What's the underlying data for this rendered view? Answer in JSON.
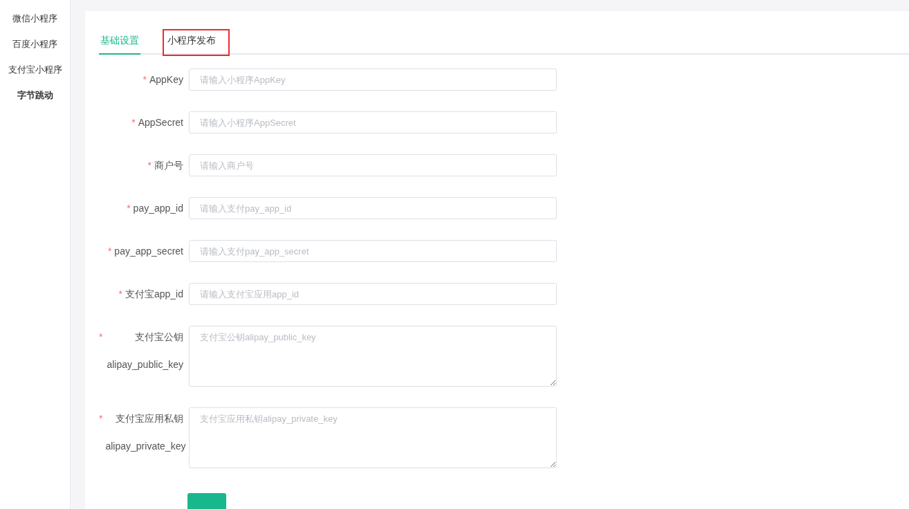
{
  "sidebar": {
    "items": [
      {
        "label": "微信小程序",
        "selected": false
      },
      {
        "label": "百度小程序",
        "selected": false
      },
      {
        "label": "支付宝小程序",
        "selected": false
      },
      {
        "label": "字节跳动",
        "selected": true
      }
    ]
  },
  "tabs": [
    {
      "label": "基础设置",
      "selected": true,
      "highlighted": false
    },
    {
      "label": "小程序发布",
      "selected": false,
      "highlighted": true
    }
  ],
  "form": {
    "fields": [
      {
        "kind": "input",
        "label": "AppKey",
        "required_mark": "*",
        "placeholder": "请输入小程序AppKey"
      },
      {
        "kind": "input",
        "label": "AppSecret",
        "required_mark": "*",
        "placeholder": "请输入小程序AppSecret"
      },
      {
        "kind": "input",
        "label": "商户号",
        "required_mark": "*",
        "placeholder": "请输入商户号"
      },
      {
        "kind": "input",
        "label": "pay_app_id",
        "required_mark": "*",
        "placeholder": "请输入支付pay_app_id"
      },
      {
        "kind": "input",
        "label": "pay_app_secret",
        "required_mark": "*",
        "placeholder": "请输入支付pay_app_secret"
      },
      {
        "kind": "input",
        "label": "支付宝app_id",
        "required_mark": "*",
        "placeholder": "请输入支付宝应用app_id"
      },
      {
        "kind": "textarea",
        "label": "支付宝公钥alipay_public_key",
        "required_mark": "*",
        "placeholder": "支付宝公钥alipay_public_key"
      },
      {
        "kind": "textarea",
        "label": "支付宝应用私钥alipay_private_key",
        "required_mark": "*",
        "placeholder": "支付宝应用私钥alipay_private_key"
      }
    ]
  }
}
